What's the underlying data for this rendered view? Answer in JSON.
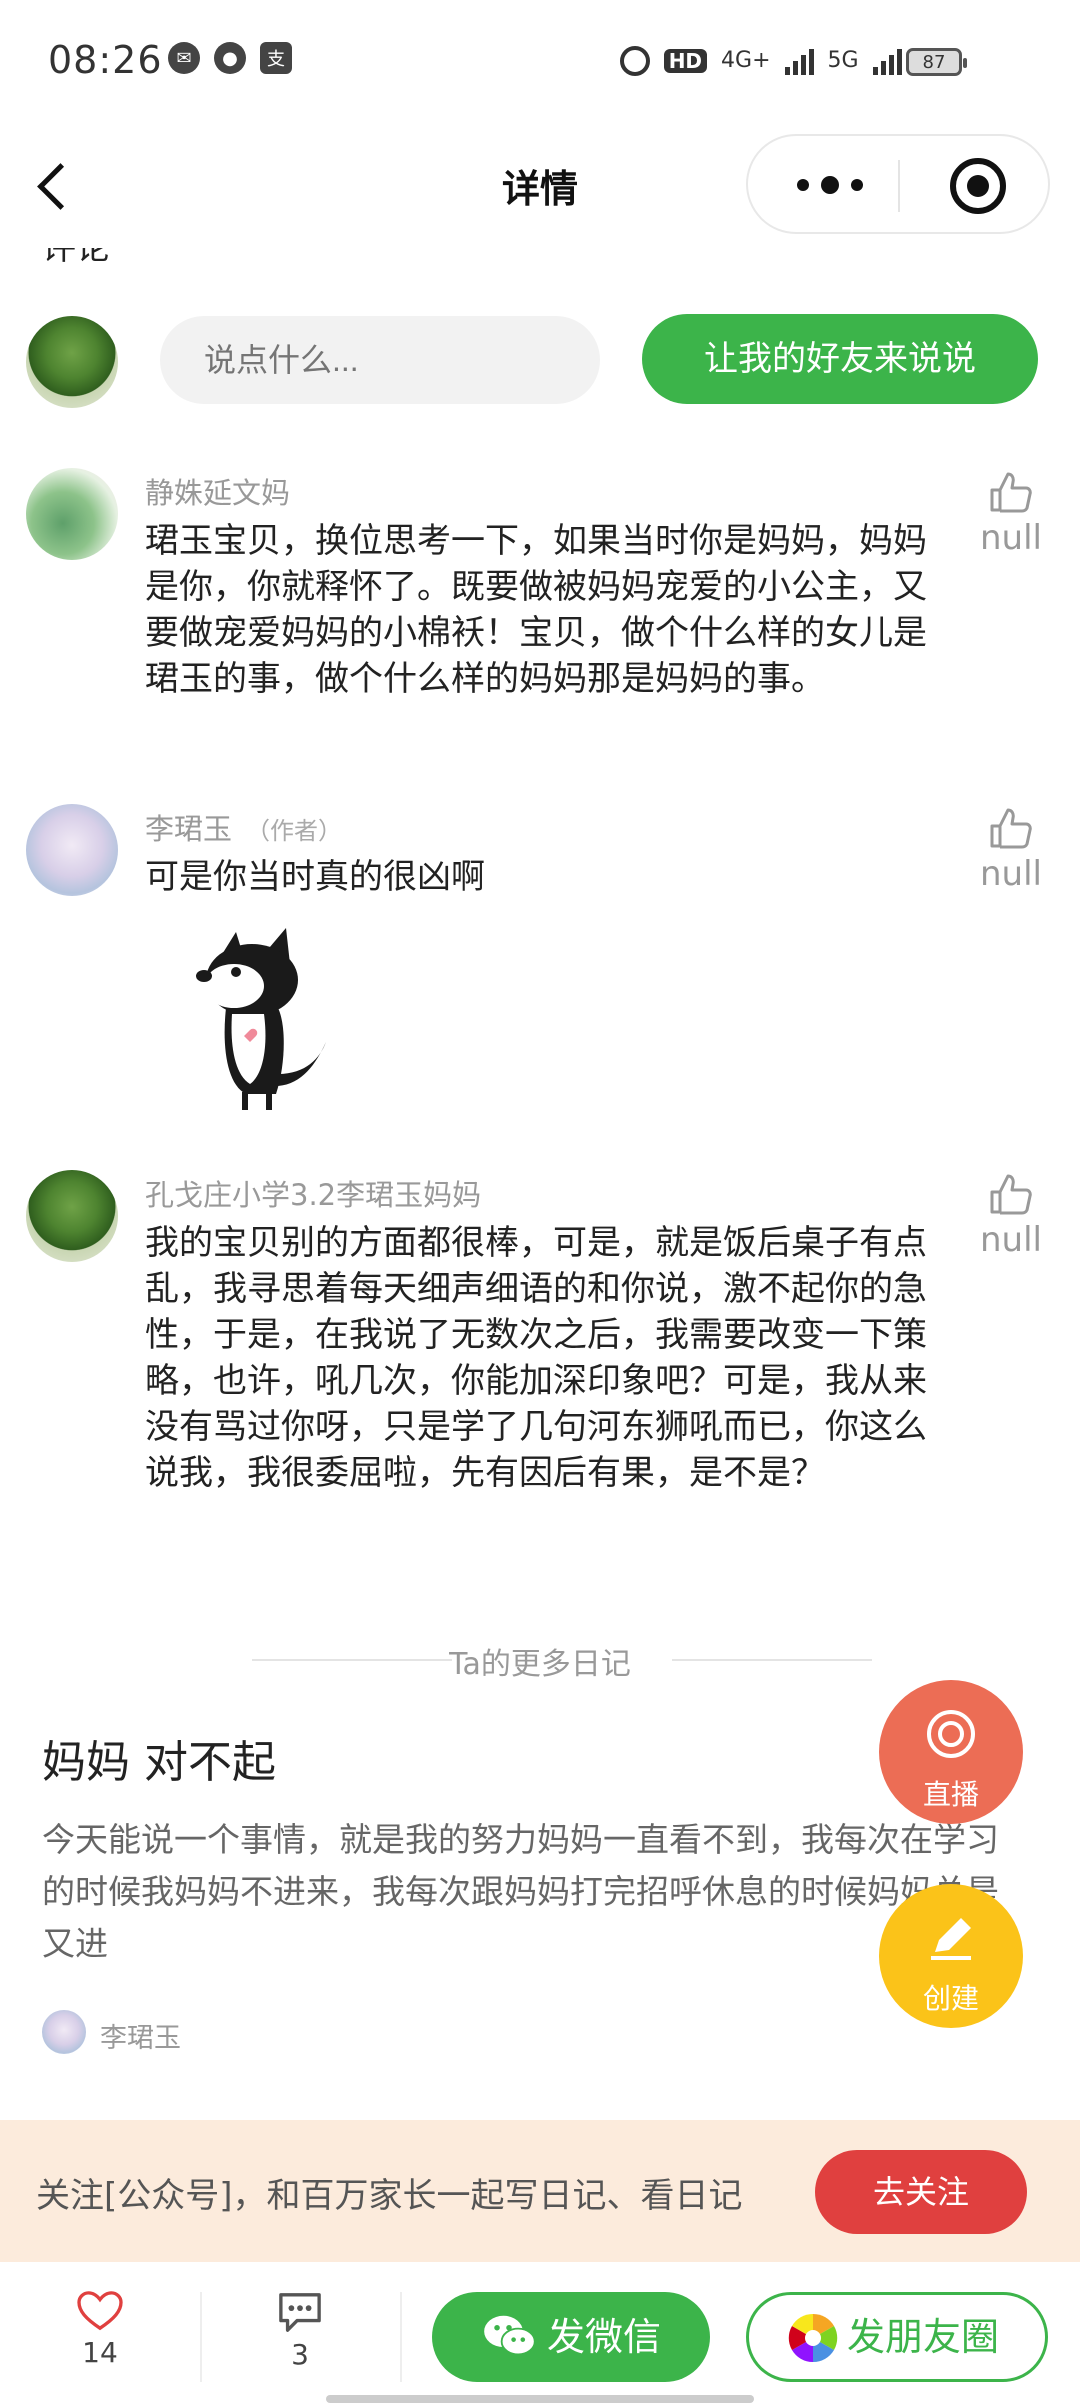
{
  "status_bar": {
    "time": "08:26",
    "battery": "87",
    "tag_hd": "HD",
    "net_4g": "4G+",
    "net_5g": "5G"
  },
  "nav": {
    "title": "详情"
  },
  "comment_input": {
    "placeholder": "说点什么...",
    "invite_label": "让我的好友来说说"
  },
  "comments": [
    {
      "name": "静姝延文妈",
      "text": "珺玉宝贝，换位思考一下，如果当时你是妈妈，妈妈是你，你就释怀了。既要做被妈妈宠爱的小公主，又要做宠爱妈妈的小棉袄！宝贝，做个什么样的女儿是珺玉的事，做个什么样的妈妈那是妈妈的事。",
      "likes": "null"
    },
    {
      "name": "李珺玉",
      "badge": "（作者）",
      "text": "可是你当时真的很凶啊",
      "likes": "null"
    },
    {
      "name": "孔戈庄小学3.2李珺玉妈妈",
      "text": "我的宝贝别的方面都很棒，可是，就是饭后桌子有点乱，我寻思着每天细声细语的和你说，激不起你的急性，于是，在我说了无数次之后，我需要改变一下策略，也许，吼几次，你能加深印象吧？可是，我从来没有骂过你呀，只是学了几句河东狮吼而已，你这么说我，我很委屈啦，先有因后有果，是不是？",
      "likes": "null"
    }
  ],
  "more_diaries": {
    "label": "Ta的更多日记",
    "title": "妈妈 对不起",
    "excerpt": "今天能说一个事情，就是我的努力妈妈一直看不到，我每次在学习的时候我妈妈不进来，我每次跟妈妈打完招呼休息的时候妈妈总是又进",
    "author": "李珺玉"
  },
  "fab": {
    "live": "直播",
    "create": "创建"
  },
  "follow_banner": {
    "text": "关注[公众号]，和百万家长一起写日记、看日记",
    "button": "去关注"
  },
  "bottom_bar": {
    "likes": "14",
    "comments": "3",
    "wechat_label": "发微信",
    "moments_label": "发朋友圈"
  },
  "colors": {
    "accent_green": "#3cb44a",
    "live_red": "#ec6d55",
    "create_yellow": "#fbc319",
    "follow_red": "#e0403f",
    "banner_bg": "#fcebdc"
  }
}
